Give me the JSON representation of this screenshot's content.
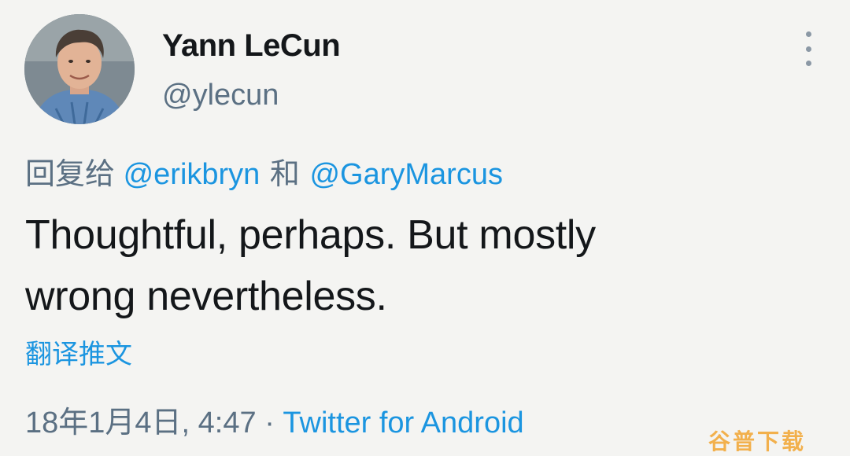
{
  "author": {
    "display_name": "Yann LeCun",
    "handle": "@ylecun"
  },
  "reply": {
    "prefix": "回复给",
    "mention_1": "@erikbryn",
    "joiner": "和",
    "mention_2": "@GaryMarcus"
  },
  "tweet": {
    "line_1": "Thoughtful, perhaps. But mostly",
    "line_2": "wrong nevertheless."
  },
  "translate_label": "翻译推文",
  "meta": {
    "timestamp": "18年1月4日, 4:47",
    "dot": "·",
    "source": "Twitter for Android"
  },
  "watermark": "谷普下载",
  "colors": {
    "link": "#1b95e0",
    "secondary": "#5b7083",
    "watermark": "#f2a93b"
  },
  "icons": [
    "more-options-icon"
  ]
}
